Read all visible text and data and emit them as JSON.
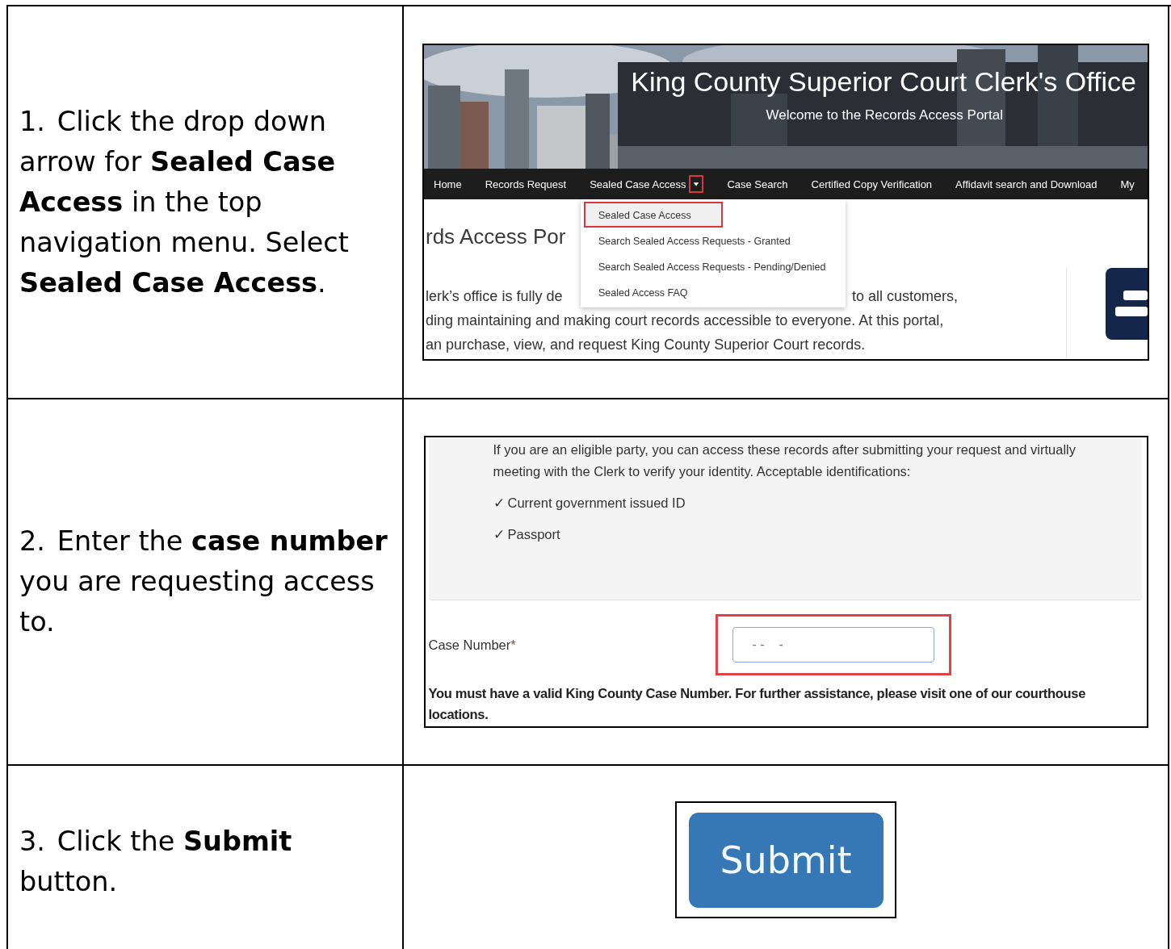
{
  "steps": [
    {
      "instruction": "1.\tClick the drop down arrow for **Sealed Case Access** in the top navigation menu. Select **Sealed Case Access**.",
      "kind": "portal"
    },
    {
      "instruction": "2.\tEnter the **case number** you are requesting access to.",
      "kind": "form"
    },
    {
      "instruction": "3.\tClick the **Submit** button.",
      "kind": "submit"
    }
  ],
  "portal": {
    "title": "King County Superior Court Clerk's Office",
    "subtitle": "Welcome to the Records Access Portal",
    "nav_items": [
      {
        "label": "Home",
        "dropdown": false
      },
      {
        "label": "Records Request",
        "dropdown": false
      },
      {
        "label": "Sealed Case Access",
        "dropdown": true
      },
      {
        "label": "Case Search",
        "dropdown": false
      },
      {
        "label": "Certified Copy Verification",
        "dropdown": false
      },
      {
        "label": "Affidavit search and Download",
        "dropdown": false
      },
      {
        "label": "My",
        "dropdown": false
      }
    ],
    "menu_items": [
      {
        "label": "Sealed Case Access",
        "highlighted": true
      },
      {
        "label": "Search Sealed Access Requests - Granted",
        "highlighted": false
      },
      {
        "label": "Search Sealed Access Requests - Pending/Denied",
        "highlighted": false
      },
      {
        "label": "Sealed Access FAQ",
        "highlighted": false
      }
    ],
    "heading": "rds Access Por",
    "line_1_left": "lerk’s office is fully de",
    "line_1_right": "to all customers,",
    "line_2": "ding maintaining and making court records accessible to everyone. At this portal,",
    "line_3": "an purchase, view, and request King County Superior Court records."
  },
  "form": {
    "info": "If you are an eligible party, you can access these records after submitting your request and virtually meeting with the Clerk to verify your identity. Acceptable identifications:",
    "ids": [
      {
        "mark": "✓",
        "label": "Current government issued ID"
      },
      {
        "mark": "✓",
        "label": "Passport"
      }
    ],
    "field_label": "Case Number",
    "required_mark": "*",
    "placeholder": "- -    -",
    "highlighted": true,
    "note": "You must have a valid King County Case Number. For further assistance, please visit one of our courthouse locations."
  },
  "submit": {
    "label": "Submit"
  }
}
